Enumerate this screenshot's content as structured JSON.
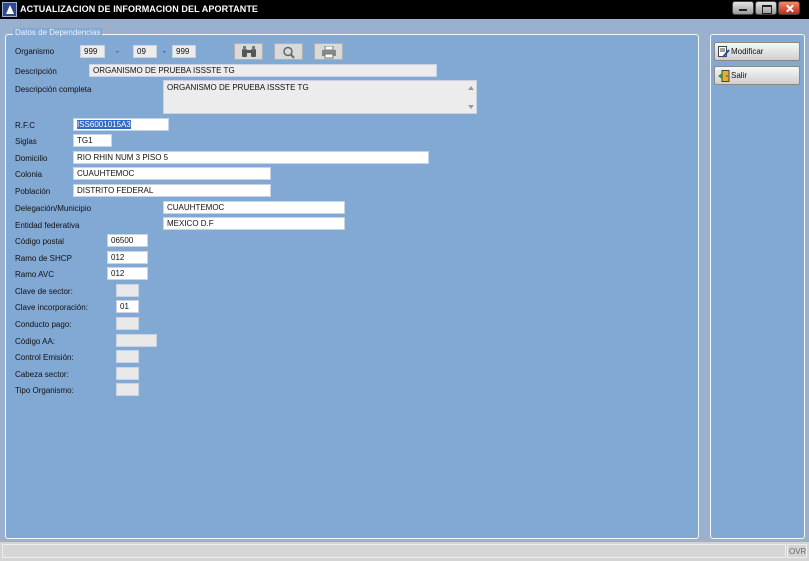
{
  "window": {
    "title": "ACTUALIZACION DE INFORMACION DEL APORTANTE"
  },
  "group": {
    "legend": "Datos de Dependencias"
  },
  "organismo": {
    "label": "Organismo",
    "part1": "999",
    "part2": "09",
    "part3": "999",
    "separator": "-"
  },
  "fields": {
    "descripcion": {
      "label": "Descripción",
      "value": "ORGANISMO DE PRUEBA ISSSTE TG"
    },
    "descripcion_completa": {
      "label": "Descripción completa",
      "value": "ORGANISMO DE PRUEBA ISSSTE TG"
    },
    "rfc": {
      "label": "R.F.C",
      "value": "ISS6001015A3"
    },
    "siglas": {
      "label": "Siglas",
      "value": "TG1"
    },
    "domicilio": {
      "label": "Domicilio",
      "value": "RIO RHIN NUM 3 PISO 5"
    },
    "colonia": {
      "label": "Colonia",
      "value": "CUAUHTEMOC"
    },
    "poblacion": {
      "label": "Población",
      "value": "DISTRITO FEDERAL"
    },
    "delegacion": {
      "label": "Delegación/Municipio",
      "value": "CUAUHTEMOC"
    },
    "entidad": {
      "label": "Entidad federativa",
      "value": "MEXICO D.F"
    },
    "codigo_postal": {
      "label": "Código postal",
      "value": "06500"
    },
    "ramo_shcp": {
      "label": "Ramo de SHCP",
      "value": "012"
    },
    "ramo_avc": {
      "label": "Ramo AVC",
      "value": "012"
    },
    "clave_sector": {
      "label": "Clave de sector:",
      "value": ""
    },
    "clave_incorporacion": {
      "label": "Clave incorporación:",
      "value": "01"
    },
    "conducto_pago": {
      "label": "Conducto pago:",
      "value": ""
    },
    "codigo_aa": {
      "label": "Código AA:",
      "value": ""
    },
    "control_emision": {
      "label": "Control Emisión:",
      "value": ""
    },
    "cabeza_sector": {
      "label": "Cabeza sector:",
      "value": ""
    },
    "tipo_organismo": {
      "label": "Tipo Organismo:",
      "value": ""
    }
  },
  "toolbar": {
    "binoculars_icon": "binoculars-icon",
    "search_icon": "magnifier-icon",
    "print_icon": "printer-icon"
  },
  "actions": {
    "modificar": "Modificar",
    "salir": "Salir"
  },
  "statusbar": {
    "ovr": "OVR"
  }
}
